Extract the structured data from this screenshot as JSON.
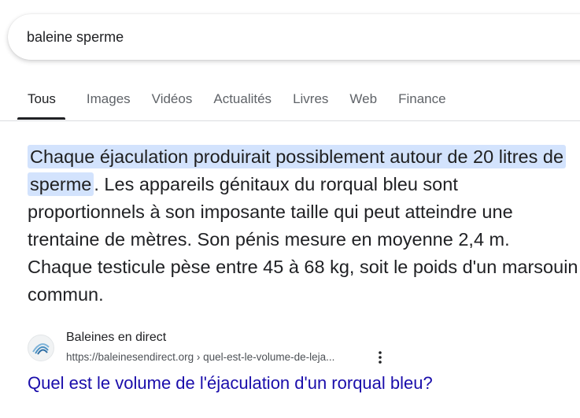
{
  "search": {
    "query": "baleine sperme"
  },
  "tabs": [
    {
      "label": "Tous",
      "active": true
    },
    {
      "label": "Images",
      "active": false
    },
    {
      "label": "Vidéos",
      "active": false
    },
    {
      "label": "Actualités",
      "active": false
    },
    {
      "label": "Livres",
      "active": false
    },
    {
      "label": "Web",
      "active": false
    },
    {
      "label": "Finance",
      "active": false
    }
  ],
  "snippet": {
    "highlighted": "Chaque éjaculation produirait possiblement autour de 20 litres de sperme",
    "rest": ". Les appareils génitaux du rorqual bleu sont proportionnels à son imposante taille qui peut atteindre une trentaine de mètres. Son pénis mesure en moyenne 2,4 m. Chaque testicule pèse entre 45 à 68 kg, soit le poids d'un marsouin commun."
  },
  "source": {
    "name": "Baleines en direct",
    "url": "https://baleinesendirect.org › quel-est-le-volume-de-leja...",
    "favicon_icon": "whale-logo-icon",
    "more_icon": "more-vert-icon"
  },
  "result": {
    "title": "Quel est le volume de l'éjaculation d'un rorqual bleu?"
  },
  "colors": {
    "highlight": "#d3e3fd",
    "link": "#1a0dab",
    "tab_inactive": "#5f6368",
    "text": "#202124"
  }
}
